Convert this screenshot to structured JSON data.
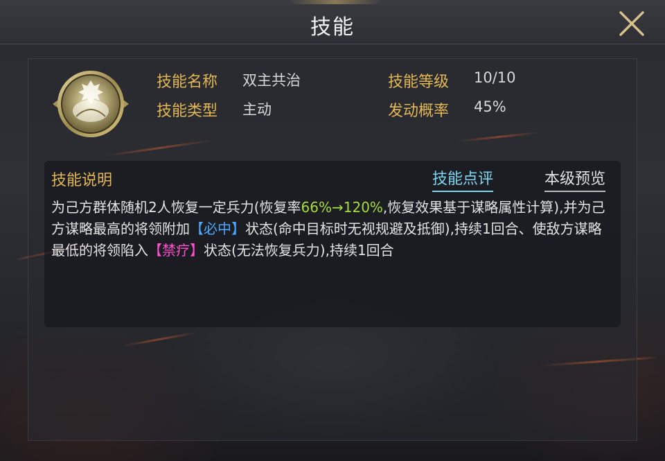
{
  "header": {
    "title": "技能"
  },
  "skill_info": {
    "name_label": "技能名称",
    "name_value": "双主共治",
    "type_label": "技能类型",
    "type_value": "主动",
    "level_label": "技能等级",
    "level_value": "10/10",
    "rate_label": "发动概率",
    "rate_value": "45%"
  },
  "description": {
    "title": "技能说明",
    "tab_review": "技能点评",
    "tab_preview": "本级预览",
    "seg1": "为己方群体随机2人恢复一定兵力(恢复率",
    "seg2": "66%→120%",
    "seg3": ",恢复效果基于谋略属性计算),并为己方谋略最高的将领附加",
    "seg4": "【必中】",
    "seg5": "状态(命中目标时无视规避及抵御),持续1回合、使敌方谋略最低的将领陷入",
    "seg6": "【禁疗】",
    "seg7": "状态(无法恢复兵力),持续1回合"
  },
  "colors": {
    "label_gold": "#e3b755",
    "highlight_green": "#a6dd3b",
    "highlight_blue": "#4aa8ff",
    "highlight_pink": "#ff4fd0",
    "tab_active": "#7fd6f2"
  },
  "icons": {
    "close": "close-x-icon",
    "skill": "skill-emblem-icon"
  }
}
